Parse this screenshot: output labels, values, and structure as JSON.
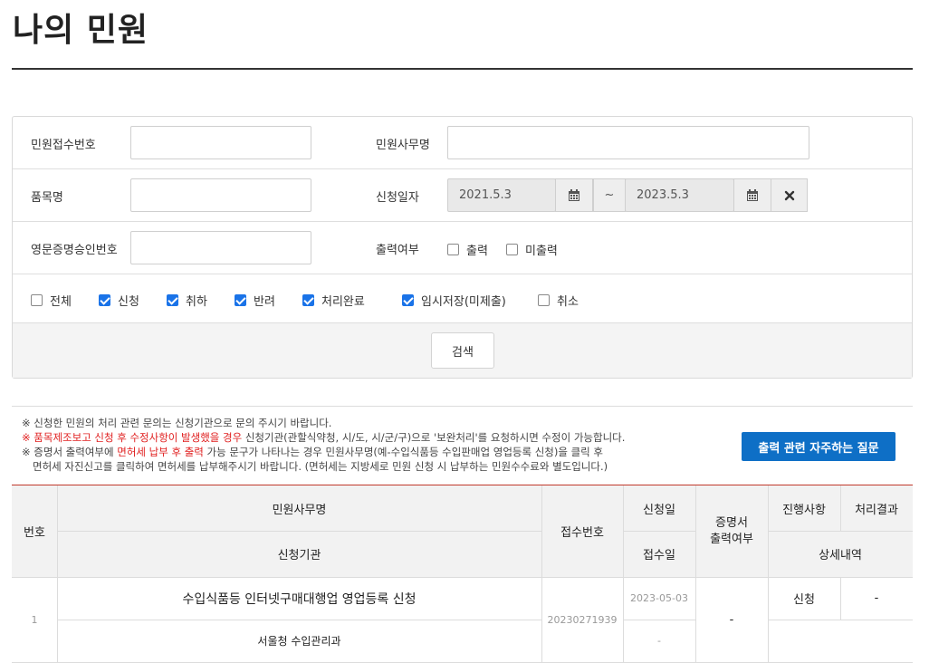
{
  "page": {
    "title": "나의 민원"
  },
  "search": {
    "receipt_no_label": "민원접수번호",
    "receipt_no_value": "",
    "service_name_label": "민원사무명",
    "service_name_value": "",
    "item_name_label": "품목명",
    "item_name_value": "",
    "apply_date_label": "신청일자",
    "date_from": "2021.5.3",
    "date_sep": "~",
    "date_to": "2023.5.3",
    "cert_no_label": "영문증명승인번호",
    "cert_no_value": "",
    "print_label": "출력여부",
    "print_options": [
      {
        "label": "출력",
        "checked": false
      },
      {
        "label": "미출력",
        "checked": false
      }
    ],
    "status_filters": [
      {
        "label": "전체",
        "checked": false
      },
      {
        "label": "신청",
        "checked": true
      },
      {
        "label": "취하",
        "checked": true
      },
      {
        "label": "반려",
        "checked": true
      },
      {
        "label": "처리완료",
        "checked": true
      },
      {
        "label": "임시저장(미제출)",
        "checked": true
      },
      {
        "label": "취소",
        "checked": false
      }
    ],
    "search_button": "검색"
  },
  "notice": {
    "line1": "※ 신청한 민원의 처리 관련 문의는 신청기관으로 문의 주시기 바랍니다.",
    "line2_prefix": "※ ",
    "line2_red": "품목제조보고 신청 후 수정사항이 발생했을 경우",
    "line2_rest": " 신청기관(관할식약청, 시/도, 시/군/구)으로 '보완처리'를 요청하시면 수정이 가능합니다.",
    "line3_prefix": "※ 증명서 출력여부에 ",
    "line3_red": "면허세 납부 후 출력",
    "line3_rest": " 가능 문구가 나타나는 경우 민원사무명(예-수입식품등 수입판매업 영업등록 신청)을 클릭 후",
    "line4": "면허세 자진신고를 클릭하여 면허세를 납부해주시기 바랍니다. (면허세는 지방세로 민원 신청 시 납부하는 민원수수료와 별도입니다.)",
    "faq_button": "출력 관련 자주하는 질문"
  },
  "table": {
    "headers": {
      "no": "번호",
      "service_name": "민원사무명",
      "agency": "신청기관",
      "receipt_no": "접수번호",
      "apply_date": "신청일",
      "receive_date": "접수일",
      "cert_print": "증명서\n출력여부",
      "progress": "진행사항",
      "result": "처리결과",
      "detail": "상세내역"
    },
    "rows": [
      {
        "no": "1",
        "service_name": "수입식품등 인터넷구매대행업 영업등록 신청",
        "agency": "서울청 수입관리과",
        "receipt_no": "20230271939",
        "apply_date": "2023-05-03",
        "receive_date": "-",
        "cert_print": "-",
        "progress": "신청",
        "result": "-"
      }
    ]
  },
  "colors": {
    "accent": "#0e6fc6",
    "checkbox": "#1a73e8",
    "warning": "#e02020",
    "table_top_border": "#c0392b"
  }
}
